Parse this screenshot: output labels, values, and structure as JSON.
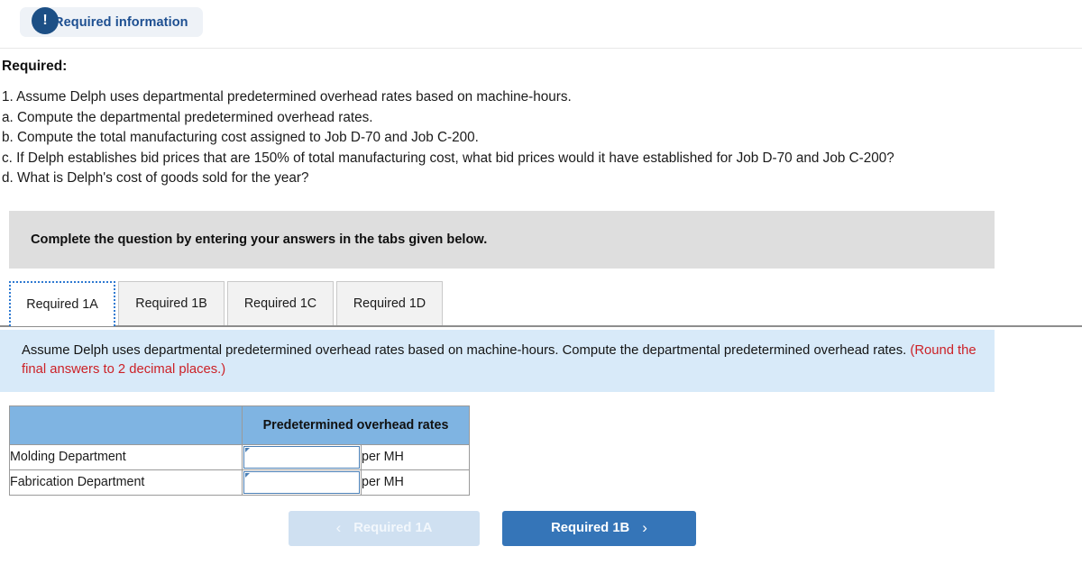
{
  "header": {
    "badge_icon": "exclamation-icon",
    "pill_label": "Required information"
  },
  "required": {
    "heading": "Required:",
    "items": [
      "1. Assume Delph uses departmental predetermined overhead rates based on machine-hours.",
      "a. Compute the departmental predetermined overhead rates.",
      "b. Compute the total manufacturing cost assigned to Job D-70 and Job C-200.",
      "c. If Delph establishes bid prices that are 150% of total manufacturing cost, what bid prices would it have established for Job D-70 and Job C-200?",
      "d. What is Delph's cost of goods sold for the year?"
    ]
  },
  "instruction_banner": {
    "text": "Complete the question by entering your answers in the tabs given below."
  },
  "tabs": {
    "items": [
      {
        "label": "Required 1A",
        "active": true
      },
      {
        "label": "Required 1B",
        "active": false
      },
      {
        "label": "Required 1C",
        "active": false
      },
      {
        "label": "Required 1D",
        "active": false
      }
    ]
  },
  "panel": {
    "text": "Assume Delph uses departmental predetermined overhead rates based on machine-hours. Compute the departmental predetermined overhead rates.",
    "note": "(Round the final answers to 2 decimal places.)"
  },
  "table": {
    "header_blank": "",
    "header_rates": "Predetermined overhead rates",
    "rows": [
      {
        "label": "Molding Department",
        "value": "",
        "unit": "per MH"
      },
      {
        "label": "Fabrication Department",
        "value": "",
        "unit": "per MH"
      }
    ]
  },
  "nav": {
    "prev_label": "Required 1A",
    "next_label": "Required 1B",
    "prev_chevron": "‹",
    "next_chevron": "›"
  },
  "colors": {
    "accent_blue": "#3575b8",
    "panel_blue": "#d8eaf9",
    "table_header_blue": "#7fb4e2",
    "banner_gray": "#dedede",
    "badge_navy": "#1c4f85",
    "note_red": "#cc2127"
  }
}
